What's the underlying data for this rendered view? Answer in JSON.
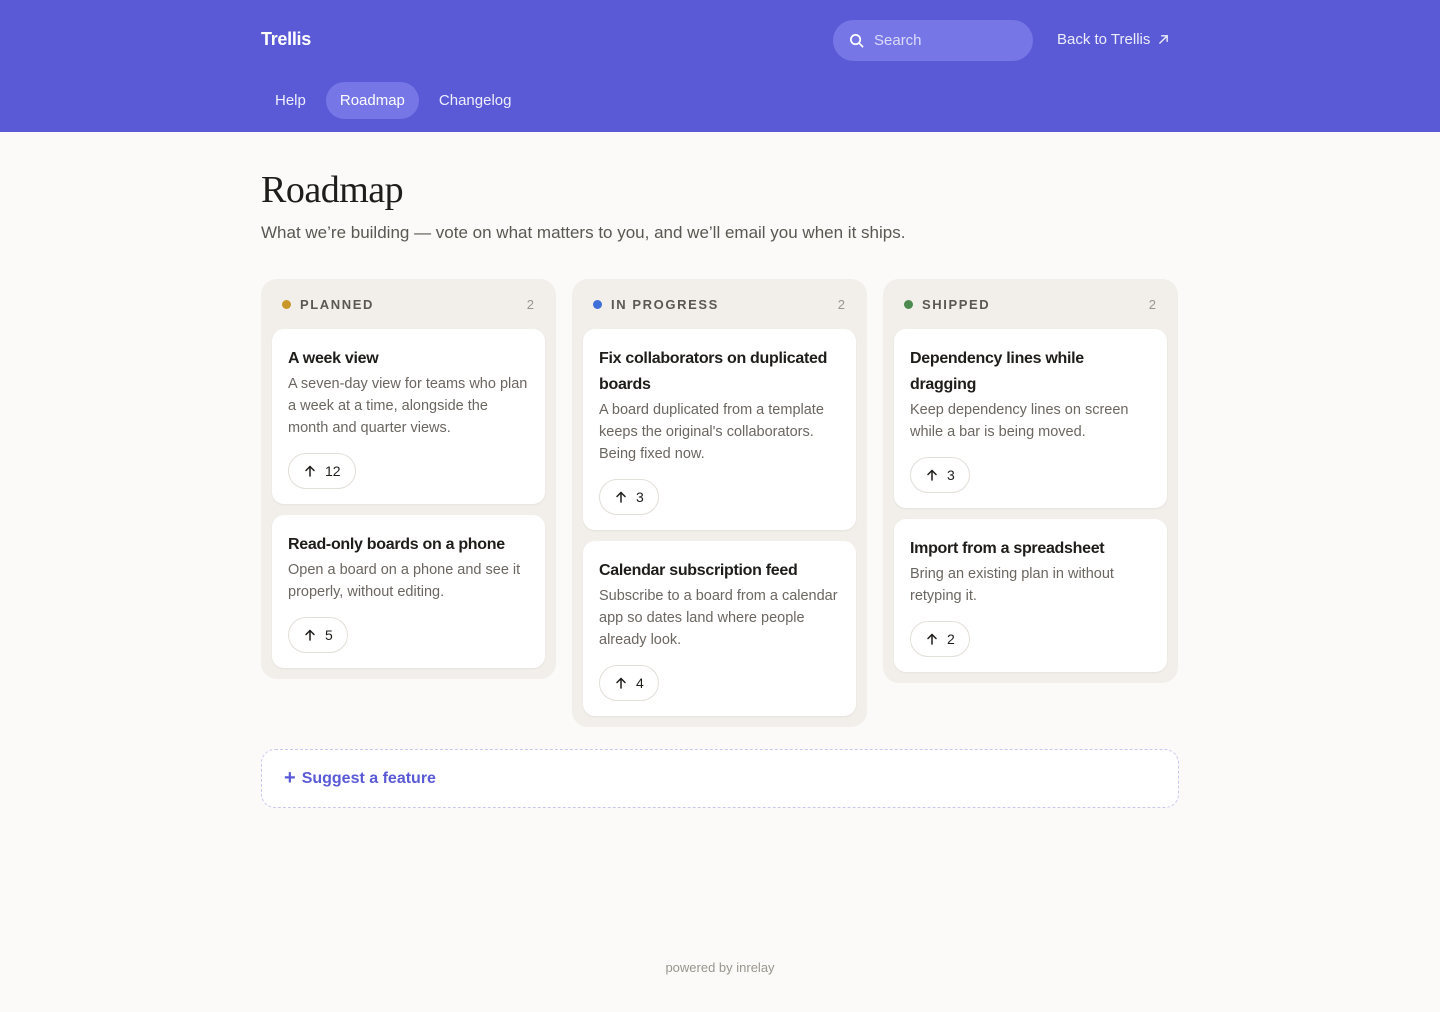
{
  "header": {
    "brand": "Trellis",
    "search_placeholder": "Search",
    "back_link": "Back to Trellis",
    "nav": [
      {
        "label": "Help",
        "active": false
      },
      {
        "label": "Roadmap",
        "active": true
      },
      {
        "label": "Changelog",
        "active": false
      }
    ],
    "colors": {
      "bar": "#5a5ad6",
      "active_tab": "#7676e6"
    }
  },
  "page": {
    "title": "Roadmap",
    "subtitle": "What we’re building — vote on what matters to you, and we’ll email you when it ships."
  },
  "columns": [
    {
      "title": "PLANNED",
      "count": "2",
      "dot_color": "#c9962a",
      "cards": [
        {
          "title": "A week view",
          "desc": "A seven-day view for teams who plan a week at a time, alongside the month and quarter views.",
          "votes": "12"
        },
        {
          "title": "Read-only boards on a phone",
          "desc": "Open a board on a phone and see it properly, without editing.",
          "votes": "5"
        }
      ]
    },
    {
      "title": "IN PROGRESS",
      "count": "2",
      "dot_color": "#3f6fd8",
      "cards": [
        {
          "title": "Fix collaborators on duplicated boards",
          "desc": "A board duplicated from a template keeps the original's collaborators. Being fixed now.",
          "votes": "3"
        },
        {
          "title": "Calendar subscription feed",
          "desc": "Subscribe to a board from a calendar app so dates land where people already look.",
          "votes": "4"
        }
      ]
    },
    {
      "title": "SHIPPED",
      "count": "2",
      "dot_color": "#4d8a4f",
      "cards": [
        {
          "title": "Dependency lines while dragging",
          "desc": "Keep dependency lines on screen while a bar is being moved.",
          "votes": "3"
        },
        {
          "title": "Import from a spreadsheet",
          "desc": "Bring an existing plan in without retyping it.",
          "votes": "2"
        }
      ]
    }
  ],
  "suggest": {
    "icon": "+",
    "label": "Suggest a feature"
  },
  "footer": {
    "text": "powered by inrelay"
  }
}
